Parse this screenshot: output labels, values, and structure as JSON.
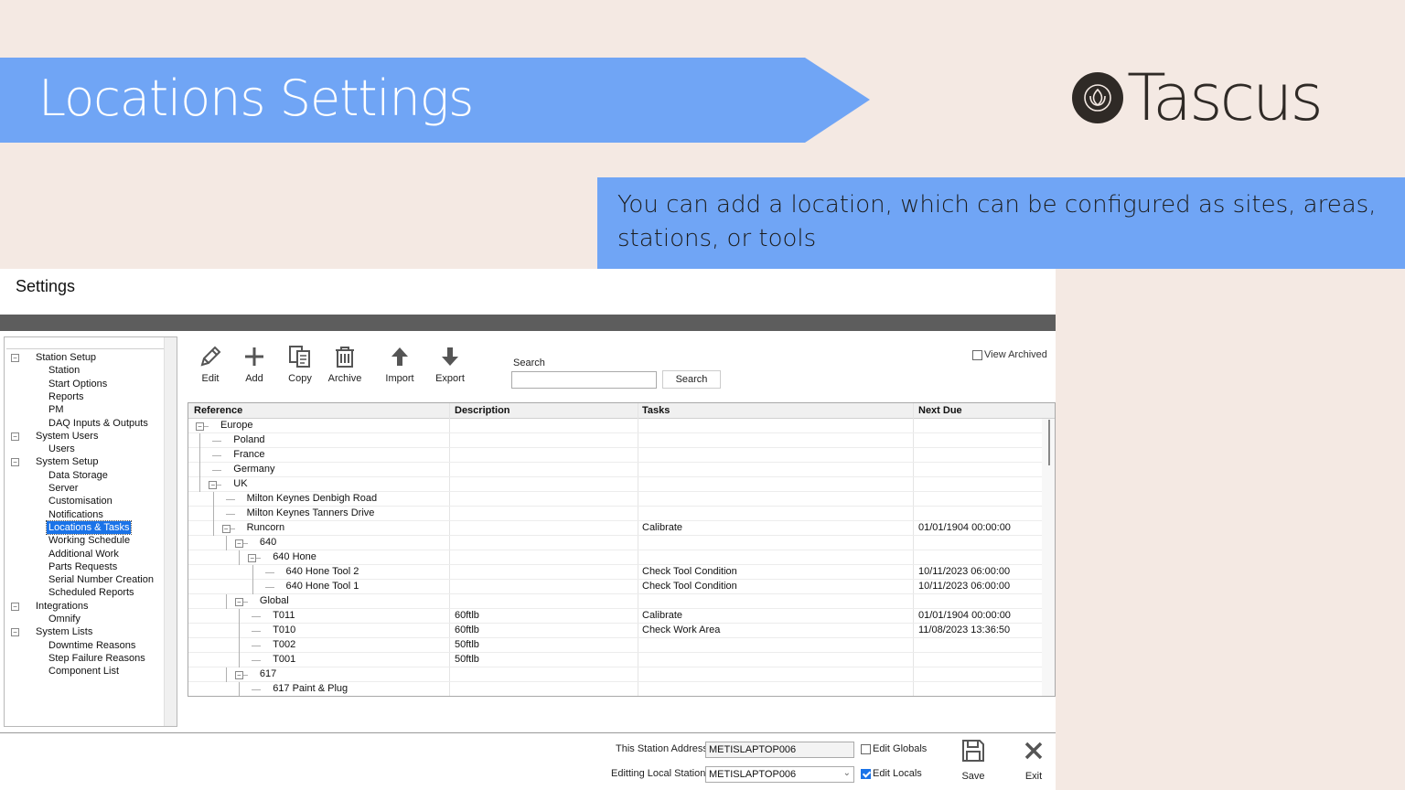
{
  "banner": {
    "title": "Locations Settings",
    "color": "#70a5f5"
  },
  "logo": {
    "text": "Tascus"
  },
  "callout": {
    "text": "You can add a location, which can be configured as sites, areas, stations, or tools"
  },
  "window": {
    "title": "Settings"
  },
  "sidebar": {
    "items": [
      {
        "label": "Station Setup",
        "level": 0,
        "expander": "⊟"
      },
      {
        "label": "Station",
        "level": 1
      },
      {
        "label": "Start Options",
        "level": 1
      },
      {
        "label": "Reports",
        "level": 1
      },
      {
        "label": "PM",
        "level": 1
      },
      {
        "label": "DAQ Inputs & Outputs",
        "level": 1
      },
      {
        "label": "System Users",
        "level": 0,
        "expander": "⊟"
      },
      {
        "label": "Users",
        "level": 1
      },
      {
        "label": "System Setup",
        "level": 0,
        "expander": "⊟"
      },
      {
        "label": "Data Storage",
        "level": 1
      },
      {
        "label": "Server",
        "level": 1
      },
      {
        "label": "Customisation",
        "level": 1
      },
      {
        "label": "Notifications",
        "level": 1
      },
      {
        "label": "Locations & Tasks",
        "level": 1,
        "selected": true
      },
      {
        "label": "Working Schedule",
        "level": 1
      },
      {
        "label": "Additional Work",
        "level": 1
      },
      {
        "label": "Parts Requests",
        "level": 1
      },
      {
        "label": "Serial Number Creation",
        "level": 1
      },
      {
        "label": "Scheduled Reports",
        "level": 1
      },
      {
        "label": "Integrations",
        "level": 0,
        "expander": "⊟"
      },
      {
        "label": "Omnify",
        "level": 1
      },
      {
        "label": "System Lists",
        "level": 0,
        "expander": "⊟"
      },
      {
        "label": "Downtime Reasons",
        "level": 1
      },
      {
        "label": "Step Failure Reasons",
        "level": 1
      },
      {
        "label": "Component List",
        "level": 1
      }
    ]
  },
  "toolbar": {
    "edit": "Edit",
    "add": "Add",
    "copy": "Copy",
    "archive": "Archive",
    "import": "Import",
    "export": "Export",
    "search_label": "Search",
    "search_button": "Search",
    "search_value": "",
    "view_archived": "View Archived"
  },
  "grid": {
    "columns": [
      "Reference",
      "Description",
      "Tasks",
      "Next Due"
    ],
    "rows": [
      {
        "ref": "Europe",
        "depth": 0,
        "expander": "⊟",
        "desc": "",
        "tasks": "",
        "due": ""
      },
      {
        "ref": "Poland",
        "depth": 1,
        "desc": "",
        "tasks": "",
        "due": ""
      },
      {
        "ref": "France",
        "depth": 1,
        "desc": "",
        "tasks": "",
        "due": ""
      },
      {
        "ref": "Germany",
        "depth": 1,
        "desc": "",
        "tasks": "",
        "due": ""
      },
      {
        "ref": "UK",
        "depth": 1,
        "expander": "⊟",
        "desc": "",
        "tasks": "",
        "due": ""
      },
      {
        "ref": "Milton Keynes Denbigh Road",
        "depth": 2,
        "desc": "",
        "tasks": "",
        "due": ""
      },
      {
        "ref": "Milton Keynes Tanners Drive",
        "depth": 2,
        "desc": "",
        "tasks": "",
        "due": ""
      },
      {
        "ref": "Runcorn",
        "depth": 2,
        "expander": "⊟",
        "desc": "",
        "tasks": "Calibrate",
        "due": "01/01/1904 00:00:00"
      },
      {
        "ref": "640",
        "depth": 3,
        "expander": "⊟",
        "desc": "",
        "tasks": "",
        "due": ""
      },
      {
        "ref": "640 Hone",
        "depth": 4,
        "expander": "⊟",
        "desc": "",
        "tasks": "",
        "due": ""
      },
      {
        "ref": "640 Hone Tool 2",
        "depth": 5,
        "desc": "",
        "tasks": "Check Tool Condition",
        "due": "10/11/2023 06:00:00"
      },
      {
        "ref": "640 Hone Tool 1",
        "depth": 5,
        "desc": "",
        "tasks": "Check Tool Condition",
        "due": "10/11/2023 06:00:00"
      },
      {
        "ref": "Global",
        "depth": 3,
        "expander": "⊟",
        "desc": "",
        "tasks": "",
        "due": ""
      },
      {
        "ref": "T011",
        "depth": 4,
        "desc": "60ftlb",
        "tasks": "Calibrate",
        "due": "01/01/1904 00:00:00"
      },
      {
        "ref": "T010",
        "depth": 4,
        "desc": "60ftlb",
        "tasks": "Check Work Area",
        "due": "11/08/2023 13:36:50"
      },
      {
        "ref": "T002",
        "depth": 4,
        "desc": "50ftlb",
        "tasks": "",
        "due": ""
      },
      {
        "ref": "T001",
        "depth": 4,
        "desc": "50ftlb",
        "tasks": "",
        "due": ""
      },
      {
        "ref": "617",
        "depth": 3,
        "expander": "⊟",
        "desc": "",
        "tasks": "",
        "due": ""
      },
      {
        "ref": "617 Paint & Plug",
        "depth": 4,
        "desc": "",
        "tasks": "",
        "due": ""
      }
    ]
  },
  "footer": {
    "station_address_label": "This Station Address",
    "station_address_value": "METISLAPTOP006",
    "editing_local_label": "Editting Local Station",
    "editing_local_value": "METISLAPTOP006",
    "edit_globals": "Edit Globals",
    "edit_locals": "Edit Locals",
    "save": "Save",
    "exit": "Exit"
  }
}
